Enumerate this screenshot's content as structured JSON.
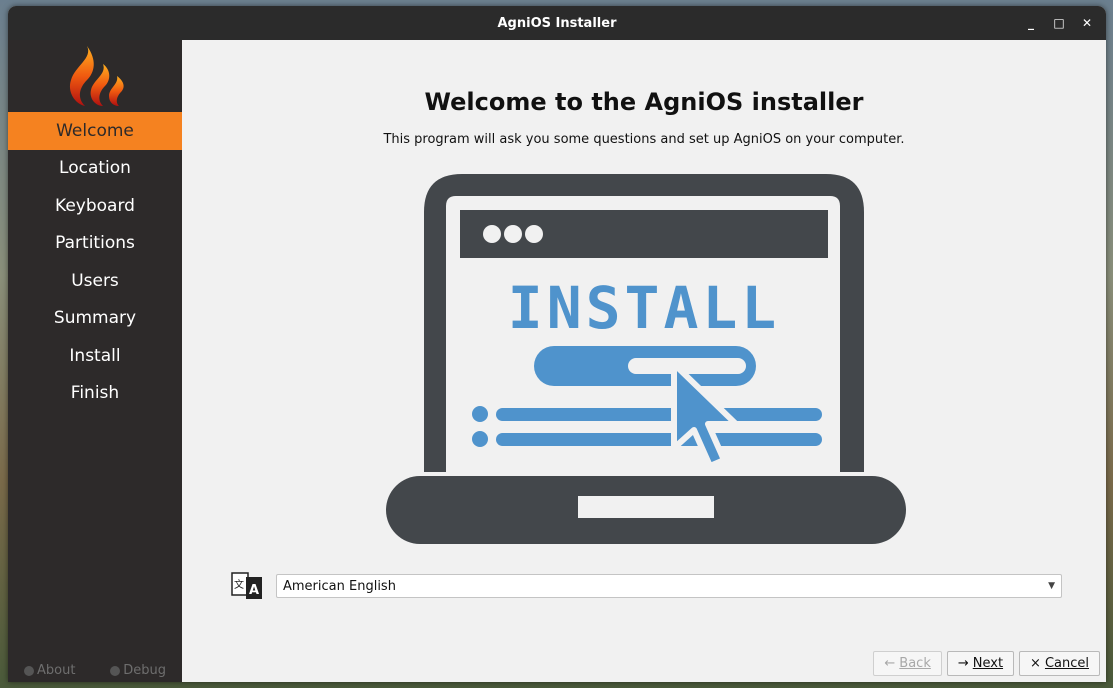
{
  "window": {
    "title": "AgniOS Installer"
  },
  "sidebar": {
    "items": [
      {
        "label": "Welcome",
        "active": true
      },
      {
        "label": "Location"
      },
      {
        "label": "Keyboard"
      },
      {
        "label": "Partitions"
      },
      {
        "label": "Users"
      },
      {
        "label": "Summary"
      },
      {
        "label": "Install"
      },
      {
        "label": "Finish"
      }
    ],
    "about_label": "About",
    "debug_label": "Debug"
  },
  "main": {
    "heading": "Welcome to the AgniOS installer",
    "subtext": "This program will ask you some questions and set up AgniOS on your computer.",
    "illustration_text": "INSTALL",
    "language": {
      "selected": "American English"
    }
  },
  "buttons": {
    "back": "Back",
    "next": "Next",
    "cancel": "Cancel"
  },
  "colors": {
    "accent": "#f58220",
    "sidebar_bg": "#2d2a2a",
    "illustration_blue": "#4f93cc",
    "illustration_dark": "#43474b"
  },
  "icons": {
    "logo": "flame-logo",
    "language": "translate-icon",
    "back": "arrow-left-icon",
    "next": "arrow-right-icon",
    "cancel": "close-icon",
    "about": "info-icon",
    "debug": "bug-icon"
  }
}
